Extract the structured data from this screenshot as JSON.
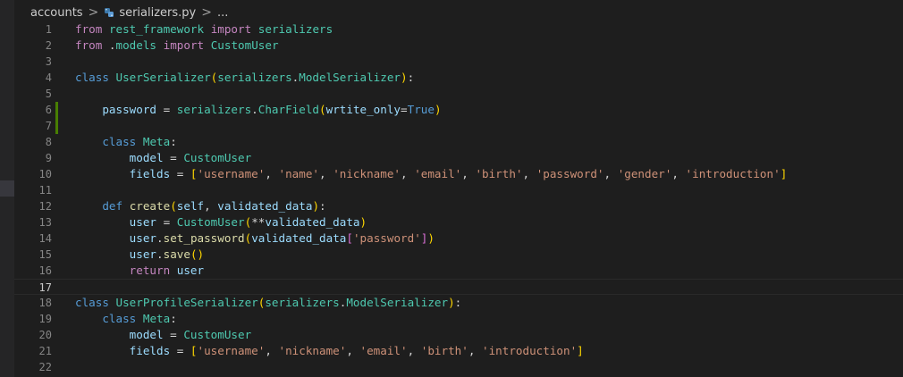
{
  "breadcrumb": {
    "folder": "accounts",
    "separator": ">",
    "file": "serializers.py",
    "more": "..."
  },
  "colors": {
    "keyword": "#c586c0",
    "declaration": "#569cd6",
    "class": "#4ec9b0",
    "function": "#dcdcaa",
    "variable": "#9cdcfe",
    "string": "#ce9178",
    "bracket_1": "#ffd700",
    "bracket_2": "#da70d6",
    "bracket_3": "#179fff",
    "git_modified": "#487e02"
  },
  "editor": {
    "current_line": 17,
    "lines": [
      {
        "n": "1",
        "t": [
          [
            "kw",
            "from"
          ],
          [
            "txt",
            " "
          ],
          [
            "cls",
            "rest_framework"
          ],
          [
            "txt",
            " "
          ],
          [
            "kw",
            "import"
          ],
          [
            "txt",
            " "
          ],
          [
            "cls",
            "serializers"
          ]
        ]
      },
      {
        "n": "2",
        "t": [
          [
            "kw",
            "from"
          ],
          [
            "txt",
            " ."
          ],
          [
            "cls",
            "models"
          ],
          [
            "txt",
            " "
          ],
          [
            "kw",
            "import"
          ],
          [
            "txt",
            " "
          ],
          [
            "cls",
            "CustomUser"
          ]
        ]
      },
      {
        "n": "3",
        "t": []
      },
      {
        "n": "4",
        "t": [
          [
            "kd",
            "class"
          ],
          [
            "txt",
            " "
          ],
          [
            "cls",
            "UserSerializer"
          ],
          [
            "b1",
            "("
          ],
          [
            "cls",
            "serializers"
          ],
          [
            "txt",
            "."
          ],
          [
            "cls",
            "ModelSerializer"
          ],
          [
            "b1",
            ")"
          ],
          [
            "txt",
            ":"
          ]
        ]
      },
      {
        "n": "5",
        "t": []
      },
      {
        "n": "6",
        "t": [
          [
            "txt",
            "    "
          ],
          [
            "var",
            "password"
          ],
          [
            "txt",
            " = "
          ],
          [
            "cls",
            "serializers"
          ],
          [
            "txt",
            "."
          ],
          [
            "cls",
            "CharField"
          ],
          [
            "b1",
            "("
          ],
          [
            "var",
            "wrtite_only"
          ],
          [
            "txt",
            "="
          ],
          [
            "kd",
            "True"
          ],
          [
            "b1",
            ")"
          ]
        ]
      },
      {
        "n": "7",
        "t": []
      },
      {
        "n": "8",
        "t": [
          [
            "txt",
            "    "
          ],
          [
            "kd",
            "class"
          ],
          [
            "txt",
            " "
          ],
          [
            "cls",
            "Meta"
          ],
          [
            "txt",
            ":"
          ]
        ]
      },
      {
        "n": "9",
        "t": [
          [
            "txt",
            "        "
          ],
          [
            "var",
            "model"
          ],
          [
            "txt",
            " = "
          ],
          [
            "cls",
            "CustomUser"
          ]
        ]
      },
      {
        "n": "10",
        "t": [
          [
            "txt",
            "        "
          ],
          [
            "var",
            "fields"
          ],
          [
            "txt",
            " = "
          ],
          [
            "b1",
            "["
          ],
          [
            "str",
            "'username'"
          ],
          [
            "txt",
            ", "
          ],
          [
            "str",
            "'name'"
          ],
          [
            "txt",
            ", "
          ],
          [
            "str",
            "'nickname'"
          ],
          [
            "txt",
            ", "
          ],
          [
            "str",
            "'email'"
          ],
          [
            "txt",
            ", "
          ],
          [
            "str",
            "'birth'"
          ],
          [
            "txt",
            ", "
          ],
          [
            "str",
            "'password'"
          ],
          [
            "txt",
            ", "
          ],
          [
            "str",
            "'gender'"
          ],
          [
            "txt",
            ", "
          ],
          [
            "str",
            "'introduction'"
          ],
          [
            "b1",
            "]"
          ]
        ]
      },
      {
        "n": "11",
        "t": []
      },
      {
        "n": "12",
        "t": [
          [
            "txt",
            "    "
          ],
          [
            "kd",
            "def"
          ],
          [
            "txt",
            " "
          ],
          [
            "fn",
            "create"
          ],
          [
            "b1",
            "("
          ],
          [
            "var",
            "self"
          ],
          [
            "txt",
            ", "
          ],
          [
            "var",
            "validated_data"
          ],
          [
            "b1",
            ")"
          ],
          [
            "txt",
            ":"
          ]
        ]
      },
      {
        "n": "13",
        "t": [
          [
            "txt",
            "        "
          ],
          [
            "var",
            "user"
          ],
          [
            "txt",
            " = "
          ],
          [
            "cls",
            "CustomUser"
          ],
          [
            "b1",
            "("
          ],
          [
            "txt",
            "**"
          ],
          [
            "var",
            "validated_data"
          ],
          [
            "b1",
            ")"
          ]
        ]
      },
      {
        "n": "14",
        "t": [
          [
            "txt",
            "        "
          ],
          [
            "var",
            "user"
          ],
          [
            "txt",
            "."
          ],
          [
            "fn",
            "set_password"
          ],
          [
            "b1",
            "("
          ],
          [
            "var",
            "validated_data"
          ],
          [
            "b2",
            "["
          ],
          [
            "str",
            "'password'"
          ],
          [
            "b2",
            "]"
          ],
          [
            "b1",
            ")"
          ]
        ]
      },
      {
        "n": "15",
        "t": [
          [
            "txt",
            "        "
          ],
          [
            "var",
            "user"
          ],
          [
            "txt",
            "."
          ],
          [
            "fn",
            "save"
          ],
          [
            "b1",
            "()"
          ]
        ]
      },
      {
        "n": "16",
        "t": [
          [
            "txt",
            "        "
          ],
          [
            "kw",
            "return"
          ],
          [
            "txt",
            " "
          ],
          [
            "var",
            "user"
          ]
        ]
      },
      {
        "n": "17",
        "t": []
      },
      {
        "n": "18",
        "t": [
          [
            "kd",
            "class"
          ],
          [
            "txt",
            " "
          ],
          [
            "cls",
            "UserProfileSerializer"
          ],
          [
            "b1",
            "("
          ],
          [
            "cls",
            "serializers"
          ],
          [
            "txt",
            "."
          ],
          [
            "cls",
            "ModelSerializer"
          ],
          [
            "b1",
            ")"
          ],
          [
            "txt",
            ":"
          ]
        ]
      },
      {
        "n": "19",
        "t": [
          [
            "txt",
            "    "
          ],
          [
            "kd",
            "class"
          ],
          [
            "txt",
            " "
          ],
          [
            "cls",
            "Meta"
          ],
          [
            "txt",
            ":"
          ]
        ]
      },
      {
        "n": "20",
        "t": [
          [
            "txt",
            "        "
          ],
          [
            "var",
            "model"
          ],
          [
            "txt",
            " = "
          ],
          [
            "cls",
            "CustomUser"
          ]
        ]
      },
      {
        "n": "21",
        "t": [
          [
            "txt",
            "        "
          ],
          [
            "var",
            "fields"
          ],
          [
            "txt",
            " = "
          ],
          [
            "b1",
            "["
          ],
          [
            "str",
            "'username'"
          ],
          [
            "txt",
            ", "
          ],
          [
            "str",
            "'nickname'"
          ],
          [
            "txt",
            ", "
          ],
          [
            "str",
            "'email'"
          ],
          [
            "txt",
            ", "
          ],
          [
            "str",
            "'birth'"
          ],
          [
            "txt",
            ", "
          ],
          [
            "str",
            "'introduction'"
          ],
          [
            "b1",
            "]"
          ]
        ]
      },
      {
        "n": "22",
        "t": []
      }
    ]
  }
}
